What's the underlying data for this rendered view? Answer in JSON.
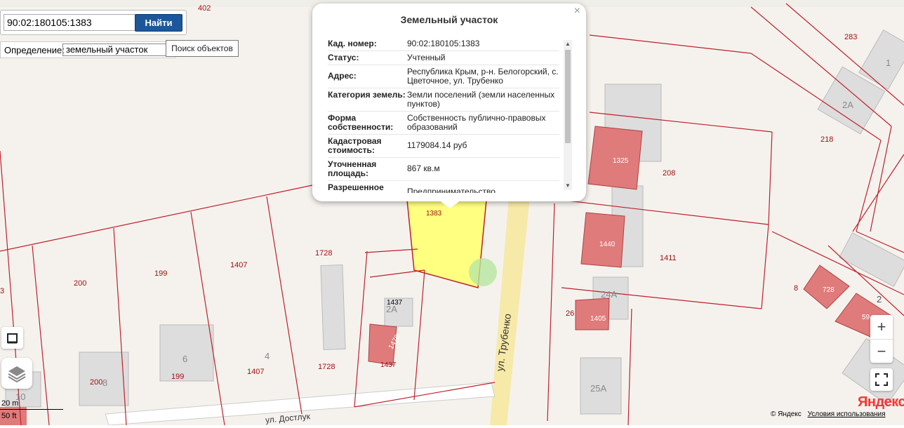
{
  "search": {
    "value": "90:02:180105:1383",
    "button_label": "Найти",
    "definition_label": "Определение:",
    "definition_value": "земельный участок",
    "tooltip": "Поиск объектов"
  },
  "popup": {
    "title": "Земельный участок",
    "close": "×",
    "rows": [
      {
        "key": "Кад. номер:",
        "value": "90:02:180105:1383"
      },
      {
        "key": "Статус:",
        "value": "Учтенный"
      },
      {
        "key": "Адрес:",
        "value": "Республика Крым, р-н. Белогорский, с. Цветочное, ул. Трубенко"
      },
      {
        "key": "Категория земель:",
        "value": "Земли поселений (земли населенных пунктов)"
      },
      {
        "key": "Форма собственности:",
        "value": "Собственность публично-правовых образований"
      },
      {
        "key": "Кадастровая стоимость:",
        "value": "1179084.14 руб"
      },
      {
        "key": "Уточненная площадь:",
        "value": "867 кв.м"
      },
      {
        "key": "Разрешенное",
        "value": "Предпринимательство"
      }
    ]
  },
  "map": {
    "parcel_numbers": [
      "402",
      "283",
      "1",
      "2А",
      "218",
      "1325",
      "208",
      "1383",
      "1440",
      "1411",
      "1728",
      "1407",
      "199",
      "200",
      "3",
      "24А",
      "8",
      "728",
      "2",
      "26",
      "1405",
      "1437",
      "2А",
      "1470",
      "1728",
      "1437",
      "4",
      "6",
      "199",
      "1407",
      "200",
      "8",
      "10",
      "25А",
      "59"
    ],
    "street_labels": [
      "ул. Трубенко",
      "ул. Достлук"
    ],
    "highlight_color": "#ffff80",
    "building_color": "#e07b7b",
    "boundary_color": "#c0202a"
  },
  "controls": {
    "zoom_in": "+",
    "zoom_out": "−",
    "ruler_icon": "ruler-icon",
    "layers_icon": "layers-icon",
    "fullscreen_icon": "fullscreen-icon"
  },
  "scale": {
    "metric": "20 m",
    "imperial": "50 ft"
  },
  "footer": {
    "copyright": "© Яндекс",
    "terms": "Условия использования",
    "logo": "Яндекс"
  }
}
